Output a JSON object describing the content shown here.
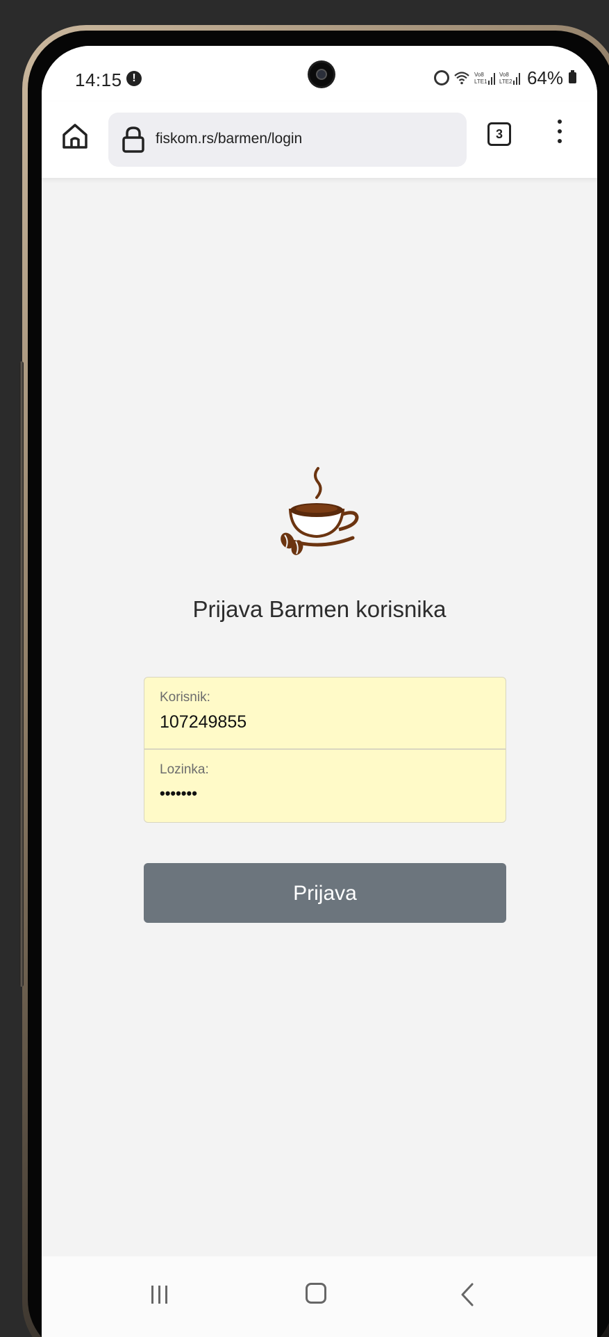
{
  "status_bar": {
    "time": "14:15",
    "alert_glyph": "!",
    "battery": "64%",
    "icons": [
      "alarm-icon",
      "wifi-icon",
      "volte-lte1-signal-icon",
      "volte-lte2-signal-icon",
      "battery-icon"
    ]
  },
  "browser": {
    "url": "fiskom.rs/barmen/login",
    "tab_count": "3",
    "icons": [
      "home-icon",
      "lock-icon",
      "tabs-icon",
      "more-vert-icon"
    ]
  },
  "login": {
    "logo": "coffee-cup-icon",
    "title": "Prijava Barmen korisnika",
    "username_label": "Korisnik:",
    "username_value": "107249855",
    "password_label": "Lozinka:",
    "password_value": "•••••••",
    "submit_label": "Prijava"
  },
  "colors": {
    "field_bg": "#fffac8",
    "button_bg": "#6c757d",
    "page_bg": "#f3f3f3"
  },
  "nav_bar": {
    "icons": [
      "recent-apps-icon",
      "home-nav-icon",
      "back-icon"
    ]
  }
}
